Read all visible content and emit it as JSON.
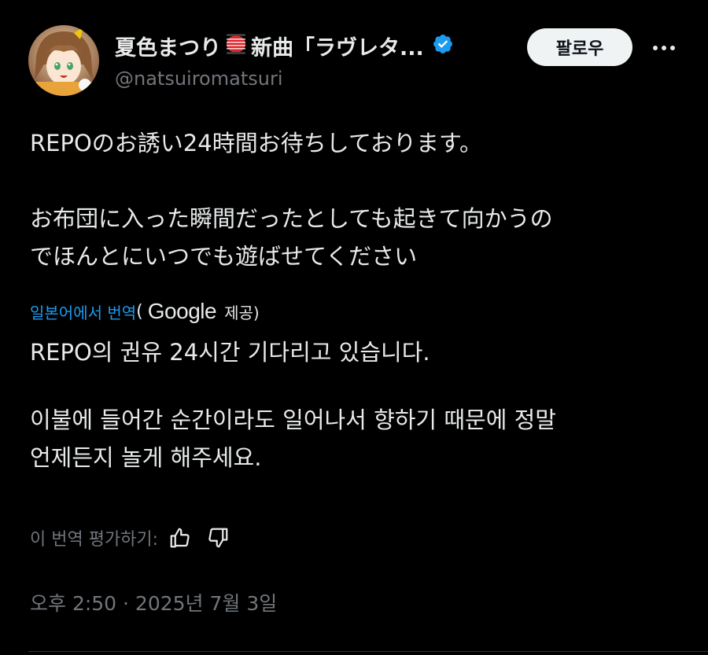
{
  "author": {
    "display_name_part1": "夏色まつり",
    "display_name_part2": "新曲「ラヴレタ...",
    "handle": "@natsuiromatsuri",
    "verified_color": "#1d9bf0"
  },
  "actions": {
    "follow_label": "팔로우",
    "more_icon": "more-horizontal-icon"
  },
  "tweet": {
    "paragraph_1": "REPOのお誘い24時間お待ちしております。",
    "paragraph_2_line_1": "お布団に入った瞬間だったとしても起きて向かうの",
    "paragraph_2_line_2": "でほんとにいつでも遊ばせてください"
  },
  "translation": {
    "link_label": "일본어에서 번역",
    "open_paren": "(",
    "provider": "Google",
    "provided_label": "제공)",
    "paragraph_1": "REPO의 권유 24시간 기다리고 있습니다.",
    "paragraph_2_line_1": "이불에 들어간 순간이라도 일어나서 향하기 때문에 정말",
    "paragraph_2_line_2": "언제든지 놀게 해주세요.",
    "rate_label": "이 번역 평가하기:"
  },
  "meta": {
    "timestamp": "오후 2:50 · 2025년 7월 3일"
  },
  "colors": {
    "background": "#000000",
    "text": "#e7e9ea",
    "muted": "#71767b",
    "link": "#1d9bf0"
  }
}
